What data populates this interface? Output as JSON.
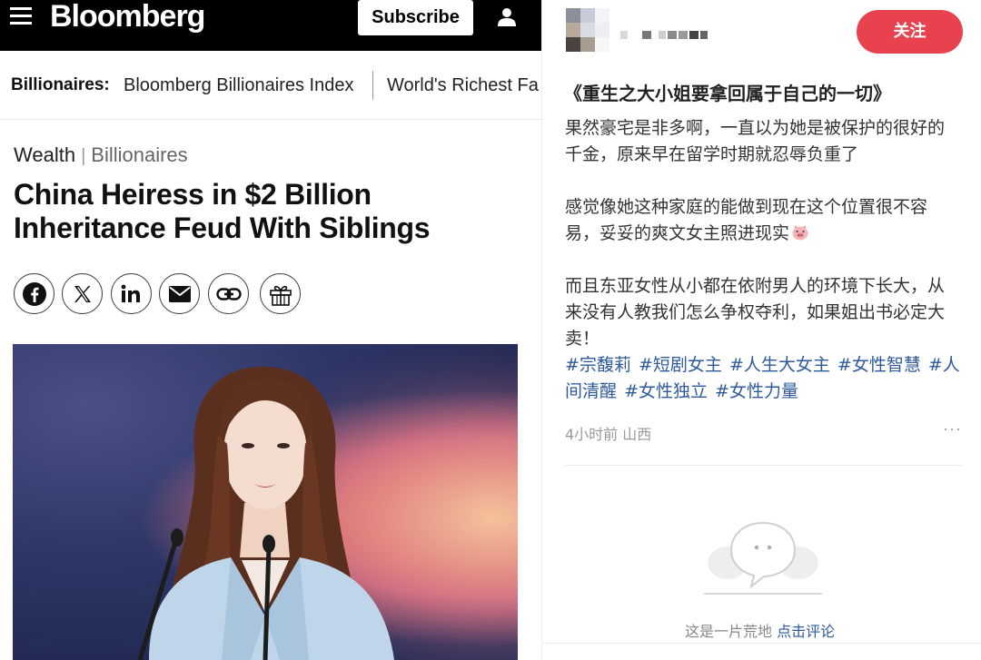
{
  "bloomberg": {
    "brand": "Bloomberg",
    "subscribe_label": "Subscribe",
    "subnav": {
      "label": "Billionaires:",
      "link1": "Bloomberg Billionaires Index",
      "link2": "World's Richest Fa"
    },
    "breadcrumb": {
      "section": "Wealth",
      "separator": "|",
      "subsection": "Billionaires"
    },
    "headline_line1": "China Heiress in $2 Billion",
    "headline_line2": "Inheritance Feud With Siblings",
    "share_icons": [
      "facebook-icon",
      "x-icon",
      "linkedin-icon",
      "email-icon",
      "link-icon",
      "gift-icon"
    ]
  },
  "post": {
    "follow_label": "关注",
    "title": "《重生之大小姐要拿回属于自己的一切》",
    "paragraphs": [
      [
        "果然豪宅是非多啊，一直以为她是被保护的很好的",
        "千金，原来早在留学时期就忍辱负重了"
      ],
      [
        "感觉像她这种家庭的能做到现在这个位置很不容",
        "易，妥妥的爽文女主照进现实"
      ],
      [
        "而且东亚女性从小都在依附男人的环境下长大，从",
        "来没有人教我们怎么争权夺利，如果姐出书必定大",
        "卖！"
      ]
    ],
    "tags": [
      "#宗馥莉",
      "#短剧女主",
      "#人生大女主",
      "#女性智慧",
      "#人",
      "间清醒",
      "#女性独立",
      "#女性力量"
    ],
    "time": "4小时前",
    "location": "山西",
    "more_label": "···",
    "empty_text": "这是一片荒地",
    "empty_link": "点击评论"
  },
  "colors": {
    "bloomberg_header": "#000000",
    "follow_button": "#e8424e",
    "tag_link": "#2e5a9c"
  }
}
